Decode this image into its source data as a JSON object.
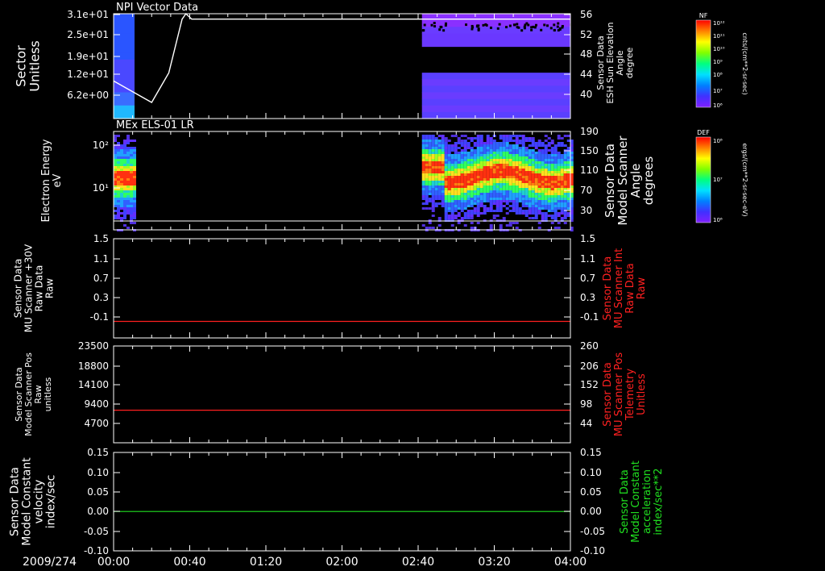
{
  "figure": {
    "date_label": "2009/274",
    "time_ticks": [
      "00:00",
      "00:40",
      "01:20",
      "02:00",
      "02:40",
      "03:20",
      "04:00"
    ]
  },
  "chart_data": [
    {
      "type": "heatmap",
      "title": "NPI Vector Data",
      "ylabel": [
        "Sector",
        "Unitless"
      ],
      "yticks": [
        "3.1e+01",
        "2.5e+01",
        "1.9e+01",
        "1.2e+01",
        "6.2e+00"
      ],
      "x_range": [
        "00:00",
        "04:00"
      ],
      "data_intervals": [
        [
          "00:00",
          "00:11"
        ],
        [
          "02:42",
          "04:00"
        ]
      ],
      "overlay_line": {
        "ylabel": [
          "Sensor Data",
          "ESH Sun Elevation",
          "Angle",
          "degree"
        ],
        "yticks": [
          56,
          52,
          48,
          44,
          40
        ],
        "ylim": [
          36.5,
          56
        ],
        "color": "#ffffff",
        "points": [
          [
            "00:00",
            43.5
          ],
          [
            "00:20",
            39.5
          ],
          [
            "00:29",
            45.0
          ],
          [
            "00:36",
            55.0
          ],
          [
            "00:38",
            56.0
          ],
          [
            "00:41",
            55.0
          ],
          [
            "04:00",
            55.0
          ]
        ]
      },
      "colorbar": {
        "label": "NF",
        "unit": "cnts/(cm**2-sr-sec)",
        "tick_labels": [
          "10¹²",
          "10¹¹",
          "10¹⁰",
          "10⁹",
          "10⁸",
          "10⁷",
          "10⁶"
        ]
      }
    },
    {
      "type": "heatmap",
      "title": "MEx ELS-01 LR",
      "ylabel": [
        "Electron Energy",
        "eV"
      ],
      "yticks": [
        "10²",
        "10¹"
      ],
      "ylog": true,
      "x_range": [
        "00:00",
        "04:00"
      ],
      "data_intervals": [
        [
          "00:00",
          "00:11"
        ],
        [
          "02:42",
          "04:00"
        ]
      ],
      "right_axis": {
        "ylabel": [
          "Sensor Data",
          "Model Scanner",
          "Angle",
          "degrees"
        ],
        "yticks": [
          190,
          150,
          110,
          70,
          30
        ]
      },
      "colorbar": {
        "label": "DEF",
        "unit": "ergs/(cm**2-sr-sec-eV)",
        "tick_labels": [
          "10⁸",
          "10⁷",
          "10⁶"
        ]
      }
    },
    {
      "type": "line",
      "ylabel": [
        "Sensor Data",
        "MU Scanner +30V",
        "Raw Data",
        "Raw"
      ],
      "yticks": [
        "1.5",
        "1.1",
        "0.7",
        "0.3",
        "-0.1"
      ],
      "ylim": [
        -0.3,
        1.5
      ],
      "right_axis": {
        "ylabel": [
          "Sensor Data",
          "MU Scanner Int",
          "Raw Data",
          "Raw"
        ],
        "yticks": [
          "1.5",
          "1.1",
          "0.7",
          "0.3",
          "-0.1"
        ],
        "color": "#ff2020"
      },
      "series": [
        {
          "color": "#ff2020",
          "x": [
            "00:00",
            "04:00"
          ],
          "y": [
            0.0,
            0.0
          ]
        }
      ]
    },
    {
      "type": "line",
      "ylabel": [
        "Sensor Data",
        "Model Scanner Pos",
        "Raw",
        "unitless"
      ],
      "yticks": [
        "23500",
        "18800",
        "14100",
        "9400",
        "4700"
      ],
      "ylim": [
        0,
        23500
      ],
      "right_axis": {
        "ylabel": [
          "Sensor Data",
          "MU Scanner Pos",
          "Telemetry",
          "Unitless"
        ],
        "yticks": [
          "260",
          "206",
          "152",
          "98",
          "44"
        ],
        "color": "#ff2020"
      },
      "series": [
        {
          "color": "#ff2020",
          "x": [
            "00:00",
            "04:00"
          ],
          "y": [
            7900,
            7900
          ]
        }
      ]
    },
    {
      "type": "line",
      "ylabel": [
        "Sensor Data",
        "Model Constant",
        "velocity",
        "index/sec"
      ],
      "yticks": [
        "0.15",
        "0.10",
        "0.05",
        "0.00",
        "-0.05",
        "-0.10"
      ],
      "ylim": [
        -0.1,
        0.15
      ],
      "right_axis": {
        "ylabel": [
          "Sensor Data",
          "Model Constant",
          "acceleration",
          "index/sec**2"
        ],
        "yticks": [
          "0.15",
          "0.10",
          "0.05",
          "0.00",
          "-0.05",
          "-0.10"
        ],
        "color": "#20e020"
      },
      "series": [
        {
          "color": "#20e020",
          "x": [
            "00:00",
            "04:00"
          ],
          "y": [
            0.0,
            0.0
          ]
        }
      ]
    }
  ]
}
